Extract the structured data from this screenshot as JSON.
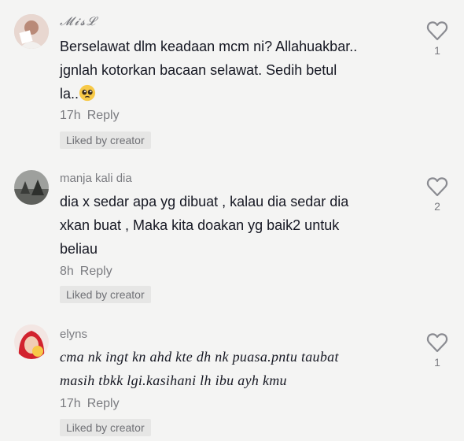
{
  "comments": [
    {
      "username": "𝓜𝓲𝓼𝓛",
      "text_lines": [
        "Berselawat dlm keadaan mcm ni? Allahuakbar..",
        "jgnlah kotorkan bacaan selawat. Sedih betul",
        "la.."
      ],
      "emoji": "pleading-face-icon",
      "time": "17h",
      "reply_label": "Reply",
      "badge": "Liked by creator",
      "likes": "1"
    },
    {
      "username": "manja kali dia",
      "text_lines": [
        "dia x sedar apa yg dibuat , kalau dia sedar dia",
        "xkan buat , Maka kita doakan yg baik2 untuk",
        "beliau"
      ],
      "time": "8h",
      "reply_label": "Reply",
      "badge": "Liked by creator",
      "likes": "2"
    },
    {
      "username": "elyns",
      "text_lines": [
        "cma nk ingt kn ahd kte dh nk puasa.pntu taubat",
        "masih tbkk lgi.kasihani lh ibu ayh kmu"
      ],
      "time": "17h",
      "reply_label": "Reply",
      "badge": "Liked by creator",
      "likes": "1"
    }
  ],
  "colors": {
    "background": "#f4f4f3",
    "text": "#161823",
    "muted": "#7a7b80",
    "badge_bg": "#e6e6e5"
  }
}
